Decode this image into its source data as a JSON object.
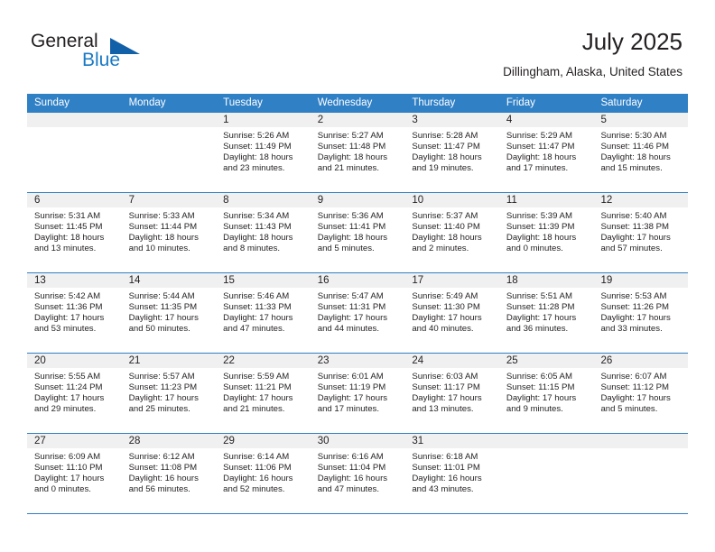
{
  "brand": {
    "name_top": "General",
    "name_bottom": "Blue",
    "accent_color": "#1260a8",
    "text_color": "#1a7ac4"
  },
  "header": {
    "title": "July 2025",
    "location": "Dillingham, Alaska, United States"
  },
  "colors": {
    "header_blue": "#3080c6",
    "day_strip_gray": "#f0f0f0",
    "text": "#231f20"
  },
  "weekdays": [
    "Sunday",
    "Monday",
    "Tuesday",
    "Wednesday",
    "Thursday",
    "Friday",
    "Saturday"
  ],
  "weeks": [
    [
      {
        "day": "",
        "sunrise": "",
        "sunset": "",
        "daylight": ""
      },
      {
        "day": "",
        "sunrise": "",
        "sunset": "",
        "daylight": ""
      },
      {
        "day": "1",
        "sunrise": "Sunrise: 5:26 AM",
        "sunset": "Sunset: 11:49 PM",
        "daylight": "Daylight: 18 hours and 23 minutes."
      },
      {
        "day": "2",
        "sunrise": "Sunrise: 5:27 AM",
        "sunset": "Sunset: 11:48 PM",
        "daylight": "Daylight: 18 hours and 21 minutes."
      },
      {
        "day": "3",
        "sunrise": "Sunrise: 5:28 AM",
        "sunset": "Sunset: 11:47 PM",
        "daylight": "Daylight: 18 hours and 19 minutes."
      },
      {
        "day": "4",
        "sunrise": "Sunrise: 5:29 AM",
        "sunset": "Sunset: 11:47 PM",
        "daylight": "Daylight: 18 hours and 17 minutes."
      },
      {
        "day": "5",
        "sunrise": "Sunrise: 5:30 AM",
        "sunset": "Sunset: 11:46 PM",
        "daylight": "Daylight: 18 hours and 15 minutes."
      }
    ],
    [
      {
        "day": "6",
        "sunrise": "Sunrise: 5:31 AM",
        "sunset": "Sunset: 11:45 PM",
        "daylight": "Daylight: 18 hours and 13 minutes."
      },
      {
        "day": "7",
        "sunrise": "Sunrise: 5:33 AM",
        "sunset": "Sunset: 11:44 PM",
        "daylight": "Daylight: 18 hours and 10 minutes."
      },
      {
        "day": "8",
        "sunrise": "Sunrise: 5:34 AM",
        "sunset": "Sunset: 11:43 PM",
        "daylight": "Daylight: 18 hours and 8 minutes."
      },
      {
        "day": "9",
        "sunrise": "Sunrise: 5:36 AM",
        "sunset": "Sunset: 11:41 PM",
        "daylight": "Daylight: 18 hours and 5 minutes."
      },
      {
        "day": "10",
        "sunrise": "Sunrise: 5:37 AM",
        "sunset": "Sunset: 11:40 PM",
        "daylight": "Daylight: 18 hours and 2 minutes."
      },
      {
        "day": "11",
        "sunrise": "Sunrise: 5:39 AM",
        "sunset": "Sunset: 11:39 PM",
        "daylight": "Daylight: 18 hours and 0 minutes."
      },
      {
        "day": "12",
        "sunrise": "Sunrise: 5:40 AM",
        "sunset": "Sunset: 11:38 PM",
        "daylight": "Daylight: 17 hours and 57 minutes."
      }
    ],
    [
      {
        "day": "13",
        "sunrise": "Sunrise: 5:42 AM",
        "sunset": "Sunset: 11:36 PM",
        "daylight": "Daylight: 17 hours and 53 minutes."
      },
      {
        "day": "14",
        "sunrise": "Sunrise: 5:44 AM",
        "sunset": "Sunset: 11:35 PM",
        "daylight": "Daylight: 17 hours and 50 minutes."
      },
      {
        "day": "15",
        "sunrise": "Sunrise: 5:46 AM",
        "sunset": "Sunset: 11:33 PM",
        "daylight": "Daylight: 17 hours and 47 minutes."
      },
      {
        "day": "16",
        "sunrise": "Sunrise: 5:47 AM",
        "sunset": "Sunset: 11:31 PM",
        "daylight": "Daylight: 17 hours and 44 minutes."
      },
      {
        "day": "17",
        "sunrise": "Sunrise: 5:49 AM",
        "sunset": "Sunset: 11:30 PM",
        "daylight": "Daylight: 17 hours and 40 minutes."
      },
      {
        "day": "18",
        "sunrise": "Sunrise: 5:51 AM",
        "sunset": "Sunset: 11:28 PM",
        "daylight": "Daylight: 17 hours and 36 minutes."
      },
      {
        "day": "19",
        "sunrise": "Sunrise: 5:53 AM",
        "sunset": "Sunset: 11:26 PM",
        "daylight": "Daylight: 17 hours and 33 minutes."
      }
    ],
    [
      {
        "day": "20",
        "sunrise": "Sunrise: 5:55 AM",
        "sunset": "Sunset: 11:24 PM",
        "daylight": "Daylight: 17 hours and 29 minutes."
      },
      {
        "day": "21",
        "sunrise": "Sunrise: 5:57 AM",
        "sunset": "Sunset: 11:23 PM",
        "daylight": "Daylight: 17 hours and 25 minutes."
      },
      {
        "day": "22",
        "sunrise": "Sunrise: 5:59 AM",
        "sunset": "Sunset: 11:21 PM",
        "daylight": "Daylight: 17 hours and 21 minutes."
      },
      {
        "day": "23",
        "sunrise": "Sunrise: 6:01 AM",
        "sunset": "Sunset: 11:19 PM",
        "daylight": "Daylight: 17 hours and 17 minutes."
      },
      {
        "day": "24",
        "sunrise": "Sunrise: 6:03 AM",
        "sunset": "Sunset: 11:17 PM",
        "daylight": "Daylight: 17 hours and 13 minutes."
      },
      {
        "day": "25",
        "sunrise": "Sunrise: 6:05 AM",
        "sunset": "Sunset: 11:15 PM",
        "daylight": "Daylight: 17 hours and 9 minutes."
      },
      {
        "day": "26",
        "sunrise": "Sunrise: 6:07 AM",
        "sunset": "Sunset: 11:12 PM",
        "daylight": "Daylight: 17 hours and 5 minutes."
      }
    ],
    [
      {
        "day": "27",
        "sunrise": "Sunrise: 6:09 AM",
        "sunset": "Sunset: 11:10 PM",
        "daylight": "Daylight: 17 hours and 0 minutes."
      },
      {
        "day": "28",
        "sunrise": "Sunrise: 6:12 AM",
        "sunset": "Sunset: 11:08 PM",
        "daylight": "Daylight: 16 hours and 56 minutes."
      },
      {
        "day": "29",
        "sunrise": "Sunrise: 6:14 AM",
        "sunset": "Sunset: 11:06 PM",
        "daylight": "Daylight: 16 hours and 52 minutes."
      },
      {
        "day": "30",
        "sunrise": "Sunrise: 6:16 AM",
        "sunset": "Sunset: 11:04 PM",
        "daylight": "Daylight: 16 hours and 47 minutes."
      },
      {
        "day": "31",
        "sunrise": "Sunrise: 6:18 AM",
        "sunset": "Sunset: 11:01 PM",
        "daylight": "Daylight: 16 hours and 43 minutes."
      },
      {
        "day": "",
        "sunrise": "",
        "sunset": "",
        "daylight": ""
      },
      {
        "day": "",
        "sunrise": "",
        "sunset": "",
        "daylight": ""
      }
    ]
  ]
}
